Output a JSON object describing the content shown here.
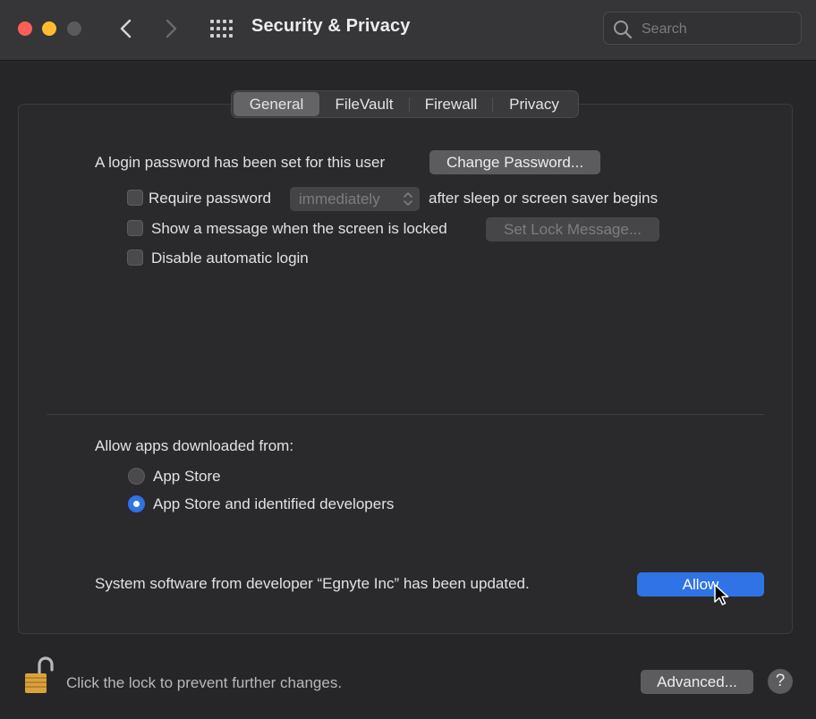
{
  "window": {
    "title": "Security & Privacy",
    "search": {
      "placeholder": "Search",
      "value": ""
    }
  },
  "tabs": [
    {
      "label": "General",
      "active": true
    },
    {
      "label": "FileVault",
      "active": false
    },
    {
      "label": "Firewall",
      "active": false
    },
    {
      "label": "Privacy",
      "active": false
    }
  ],
  "general": {
    "login_text": "A login password has been set for this user",
    "change_password_label": "Change Password...",
    "require_password": {
      "checked": false,
      "label": "Require password",
      "delay_value": "immediately",
      "suffix": "after sleep or screen saver begins"
    },
    "show_message": {
      "checked": false,
      "label": "Show a message when the screen is locked",
      "button_label": "Set Lock Message..."
    },
    "disable_auto_login": {
      "checked": false,
      "label": "Disable automatic login"
    }
  },
  "apps": {
    "heading": "Allow apps downloaded from:",
    "options": [
      {
        "label": "App Store",
        "selected": false
      },
      {
        "label": "App Store and identified developers",
        "selected": true
      }
    ]
  },
  "notice": {
    "text": "System software from developer “Egnyte Inc” has been updated.",
    "allow_label": "Allow"
  },
  "footer": {
    "lock_text": "Click the lock to prevent further changes.",
    "advanced_label": "Advanced...",
    "help_label": "?"
  },
  "colors": {
    "accent": "#2f73e6",
    "close": "#fe5f57",
    "minimize": "#febc2e",
    "lock": "#d9a23c"
  },
  "icons": [
    "close-icon",
    "minimize-icon",
    "zoom-icon",
    "chevron-left-icon",
    "chevron-right-icon",
    "grid-icon",
    "search-icon",
    "updown-chevron-icon",
    "lock-icon",
    "cursor-icon"
  ]
}
